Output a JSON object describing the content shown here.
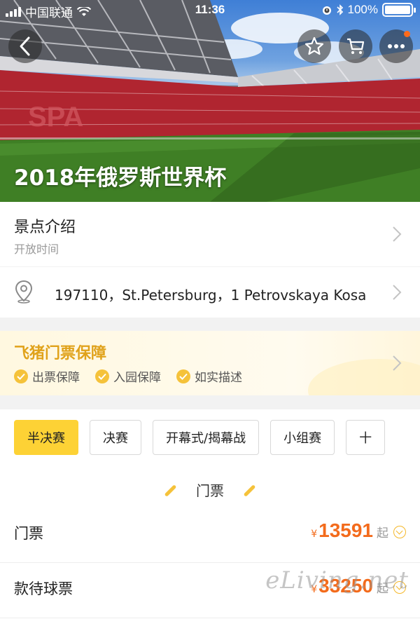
{
  "status_bar": {
    "carrier": "中国联通",
    "time": "11:36",
    "battery_percent": "100%",
    "battery_level": 1.0
  },
  "header": {
    "title": "2018年俄罗斯世界杯",
    "icons": [
      "back-icon",
      "star-icon",
      "cart-icon",
      "more-icon"
    ]
  },
  "intro": {
    "title": "景点介绍",
    "subtitle": "开放时间"
  },
  "address": {
    "text": "197110，St.Petersburg，1 Petrovskaya Kosa"
  },
  "guarantee": {
    "title": "飞猪门票保障",
    "items": [
      "出票保障",
      "入园保障",
      "如实描述"
    ]
  },
  "tabs": [
    "半决赛",
    "决赛",
    "开幕式/揭幕战",
    "小组赛",
    "十"
  ],
  "active_tab": "半决赛",
  "section": {
    "title": "门票"
  },
  "tickets": [
    {
      "label": "门票",
      "currency": "¥",
      "price": "13591",
      "suffix": "起"
    },
    {
      "label": "款待球票",
      "currency": "¥",
      "price": "33250",
      "suffix": "起"
    }
  ],
  "watermark": "eLiving.net",
  "colors": {
    "accent_yellow": "#fdd235",
    "price_orange": "#f36b1c",
    "guarantee_gold": "#e0a21a"
  }
}
